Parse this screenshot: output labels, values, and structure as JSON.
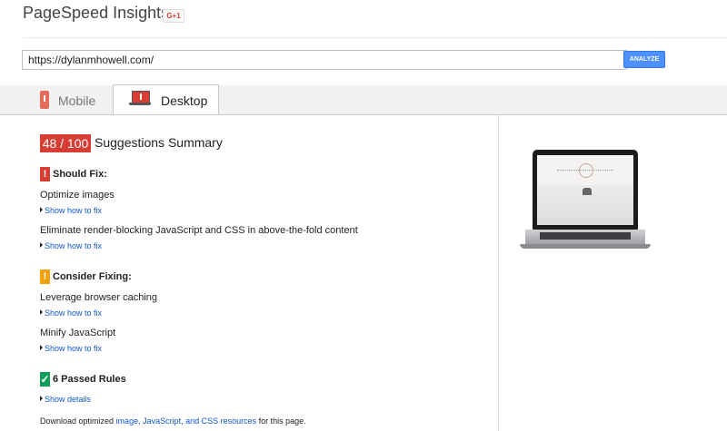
{
  "header": {
    "title": "PageSpeed Insights",
    "gplus_label": "G+1"
  },
  "search": {
    "url_value": "https://dylanmhowell.com/",
    "analyze_label": "ANALYZE"
  },
  "tabs": [
    {
      "label": "Mobile",
      "icon": "mobile-phone-icon",
      "active": false
    },
    {
      "label": "Desktop",
      "icon": "laptop-icon",
      "active": true
    }
  ],
  "summary": {
    "score": "48 / 100",
    "title": "Suggestions Summary",
    "score_color": "#d73d32"
  },
  "should_fix": {
    "badge": "!",
    "title": "Should Fix:",
    "color": "#d73d32",
    "rules": [
      {
        "name": "Optimize images",
        "link": "Show how to fix"
      },
      {
        "name": "Eliminate render-blocking JavaScript and CSS in above-the-fold content",
        "link": "Show how to fix"
      }
    ]
  },
  "consider_fixing": {
    "badge": "!",
    "title": "Consider Fixing:",
    "color": "#f5a10a",
    "rules": [
      {
        "name": "Leverage browser caching",
        "link": "Show how to fix"
      },
      {
        "name": "Minify JavaScript",
        "link": "Show how to fix"
      }
    ]
  },
  "passed": {
    "badge": "✓",
    "title": "6 Passed Rules",
    "link": "Show details",
    "color": "#109d59"
  },
  "footer": {
    "prefix": "Download optimized",
    "link": "image, JavaScript, and CSS resources",
    "suffix": "for this page."
  }
}
